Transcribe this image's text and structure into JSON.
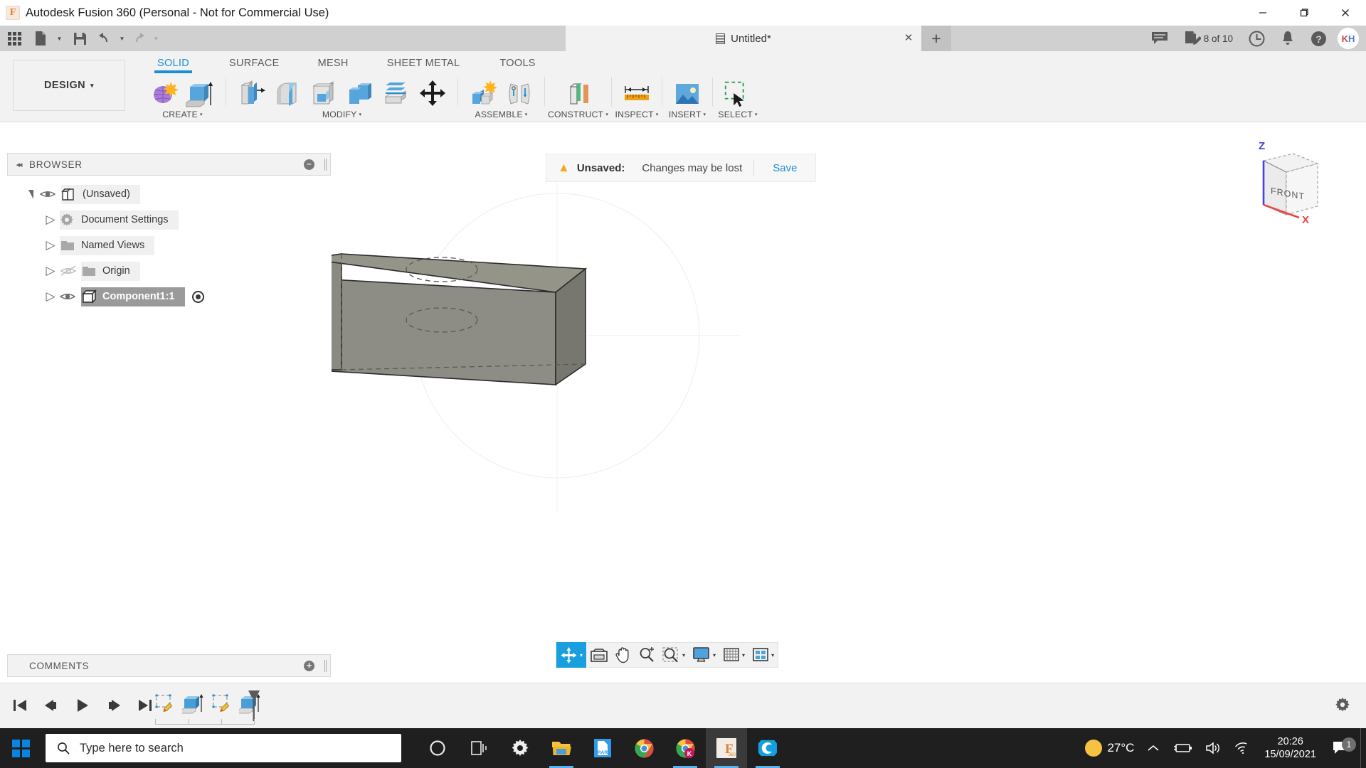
{
  "window": {
    "title": "Autodesk Fusion 360 (Personal - Not for Commercial Use)",
    "app_badge": "F",
    "minimize": "─",
    "maximize": "❐",
    "close": "✕"
  },
  "quick_access": {
    "grid_icon": "app-grid-icon",
    "new_icon": "new-document-icon",
    "save_icon": "save-icon",
    "undo_icon": "undo-icon",
    "redo_icon": "redo-icon",
    "caret": "▾"
  },
  "document_tab": {
    "name": "Untitled*",
    "close": "✕",
    "new_tab": "+"
  },
  "top_right": {
    "comment_icon": "comment-icon",
    "jobs_icon": "job-status-icon",
    "jobs_label": "8 of 10",
    "history_icon": "clock-icon",
    "notification_icon": "bell-icon",
    "help_icon": "help-icon",
    "avatar_initial_1": "K",
    "avatar_initial_2": "H"
  },
  "workspace": {
    "selector": "DESIGN",
    "selector_caret": "▾",
    "tabs": [
      {
        "label": "SOLID",
        "active": true
      },
      {
        "label": "SURFACE",
        "active": false
      },
      {
        "label": "MESH",
        "active": false
      },
      {
        "label": "SHEET METAL",
        "active": false
      },
      {
        "label": "TOOLS",
        "active": false
      }
    ],
    "groups": [
      {
        "label": "CREATE",
        "caret": "▾"
      },
      {
        "label": "MODIFY",
        "caret": "▾"
      },
      {
        "label": "ASSEMBLE",
        "caret": "▾"
      },
      {
        "label": "CONSTRUCT",
        "caret": "▾"
      },
      {
        "label": "INSPECT",
        "caret": "▾"
      },
      {
        "label": "INSERT",
        "caret": "▾"
      },
      {
        "label": "SELECT",
        "caret": "▾"
      }
    ]
  },
  "browser": {
    "title": "BROWSER",
    "collapse_icon": "◂◂",
    "panel_toggle": "⊖",
    "tree": [
      {
        "label": "(Unsaved)",
        "icon": "document-cube-icon",
        "expanded": true,
        "visible": true,
        "selected": false,
        "indent": 0
      },
      {
        "label": "Document Settings",
        "icon": "gear-icon",
        "expanded": false,
        "visible": null,
        "selected": false,
        "indent": 1
      },
      {
        "label": "Named Views",
        "icon": "folder-icon",
        "expanded": false,
        "visible": null,
        "selected": false,
        "indent": 1
      },
      {
        "label": "Origin",
        "icon": "folder-icon",
        "expanded": false,
        "visible": false,
        "selected": false,
        "indent": 1
      },
      {
        "label": "Component1:1",
        "icon": "component-cube-icon",
        "expanded": false,
        "visible": true,
        "selected": true,
        "indent": 1
      }
    ]
  },
  "unsaved_banner": {
    "warning_icon": "warning-triangle-icon",
    "label": "Unsaved:",
    "message": "Changes may be lost",
    "save_link": "Save"
  },
  "viewcube": {
    "face_label": "FRONT",
    "axis_z": "Z",
    "axis_x": "X",
    "axis_z_color": "#4444dd",
    "axis_x_color": "#ee4444"
  },
  "model": {
    "description": "rectangular block with two hidden circular holes",
    "face_color": "#8a8a82",
    "edge_color": "#333333"
  },
  "comments": {
    "title": "COMMENTS",
    "add_icon": "⊕"
  },
  "navbar": {
    "items": [
      {
        "name": "orbit-tool",
        "active": true,
        "has_caret": true
      },
      {
        "name": "look-at-tool",
        "active": false,
        "has_caret": false
      },
      {
        "name": "pan-tool",
        "active": false,
        "has_caret": false
      },
      {
        "name": "zoom-tool",
        "active": false,
        "has_caret": false
      },
      {
        "name": "zoom-window-tool",
        "active": false,
        "has_caret": true
      },
      {
        "name": "display-settings",
        "active": false,
        "has_caret": true
      },
      {
        "name": "grid-snap-settings",
        "active": false,
        "has_caret": true
      },
      {
        "name": "viewport-layout",
        "active": false,
        "has_caret": true
      }
    ],
    "caret": "▾"
  },
  "timeline": {
    "controls": [
      {
        "name": "jump-to-beginning"
      },
      {
        "name": "step-back"
      },
      {
        "name": "play"
      },
      {
        "name": "step-forward"
      },
      {
        "name": "jump-to-end"
      }
    ],
    "features": [
      {
        "name": "sketch-feature-1",
        "type": "sketch"
      },
      {
        "name": "extrude-feature-1",
        "type": "extrude"
      },
      {
        "name": "sketch-feature-2",
        "type": "sketch"
      },
      {
        "name": "extrude-feature-2",
        "type": "extrude"
      }
    ],
    "marker": "timeline-end-marker",
    "settings_icon": "gear-icon"
  },
  "taskbar": {
    "start_icon": "windows-start-icon",
    "search_placeholder": "Type here to search",
    "search_icon": "search-icon",
    "apps": [
      {
        "name": "cortana-icon",
        "running": false
      },
      {
        "name": "task-view-icon",
        "running": false
      },
      {
        "name": "settings-icon",
        "running": false
      },
      {
        "name": "file-explorer-icon",
        "running": true
      },
      {
        "name": "winrar-icon",
        "running": false
      },
      {
        "name": "chrome-icon",
        "running": false
      },
      {
        "name": "chrome-profile-icon",
        "running": true
      },
      {
        "name": "fusion360-icon",
        "running": true,
        "active": true
      },
      {
        "name": "cura-icon",
        "running": true
      }
    ],
    "tray": {
      "weather_icon": "sunny-icon",
      "temperature": "27°C",
      "overflow_caret": "⌃",
      "battery_icon": "battery-charging-icon",
      "volume_icon": "speaker-icon",
      "network_icon": "wifi-icon",
      "time": "20:26",
      "date": "15/09/2021",
      "action_center_icon": "notification-icon",
      "notification_count": "1"
    }
  }
}
